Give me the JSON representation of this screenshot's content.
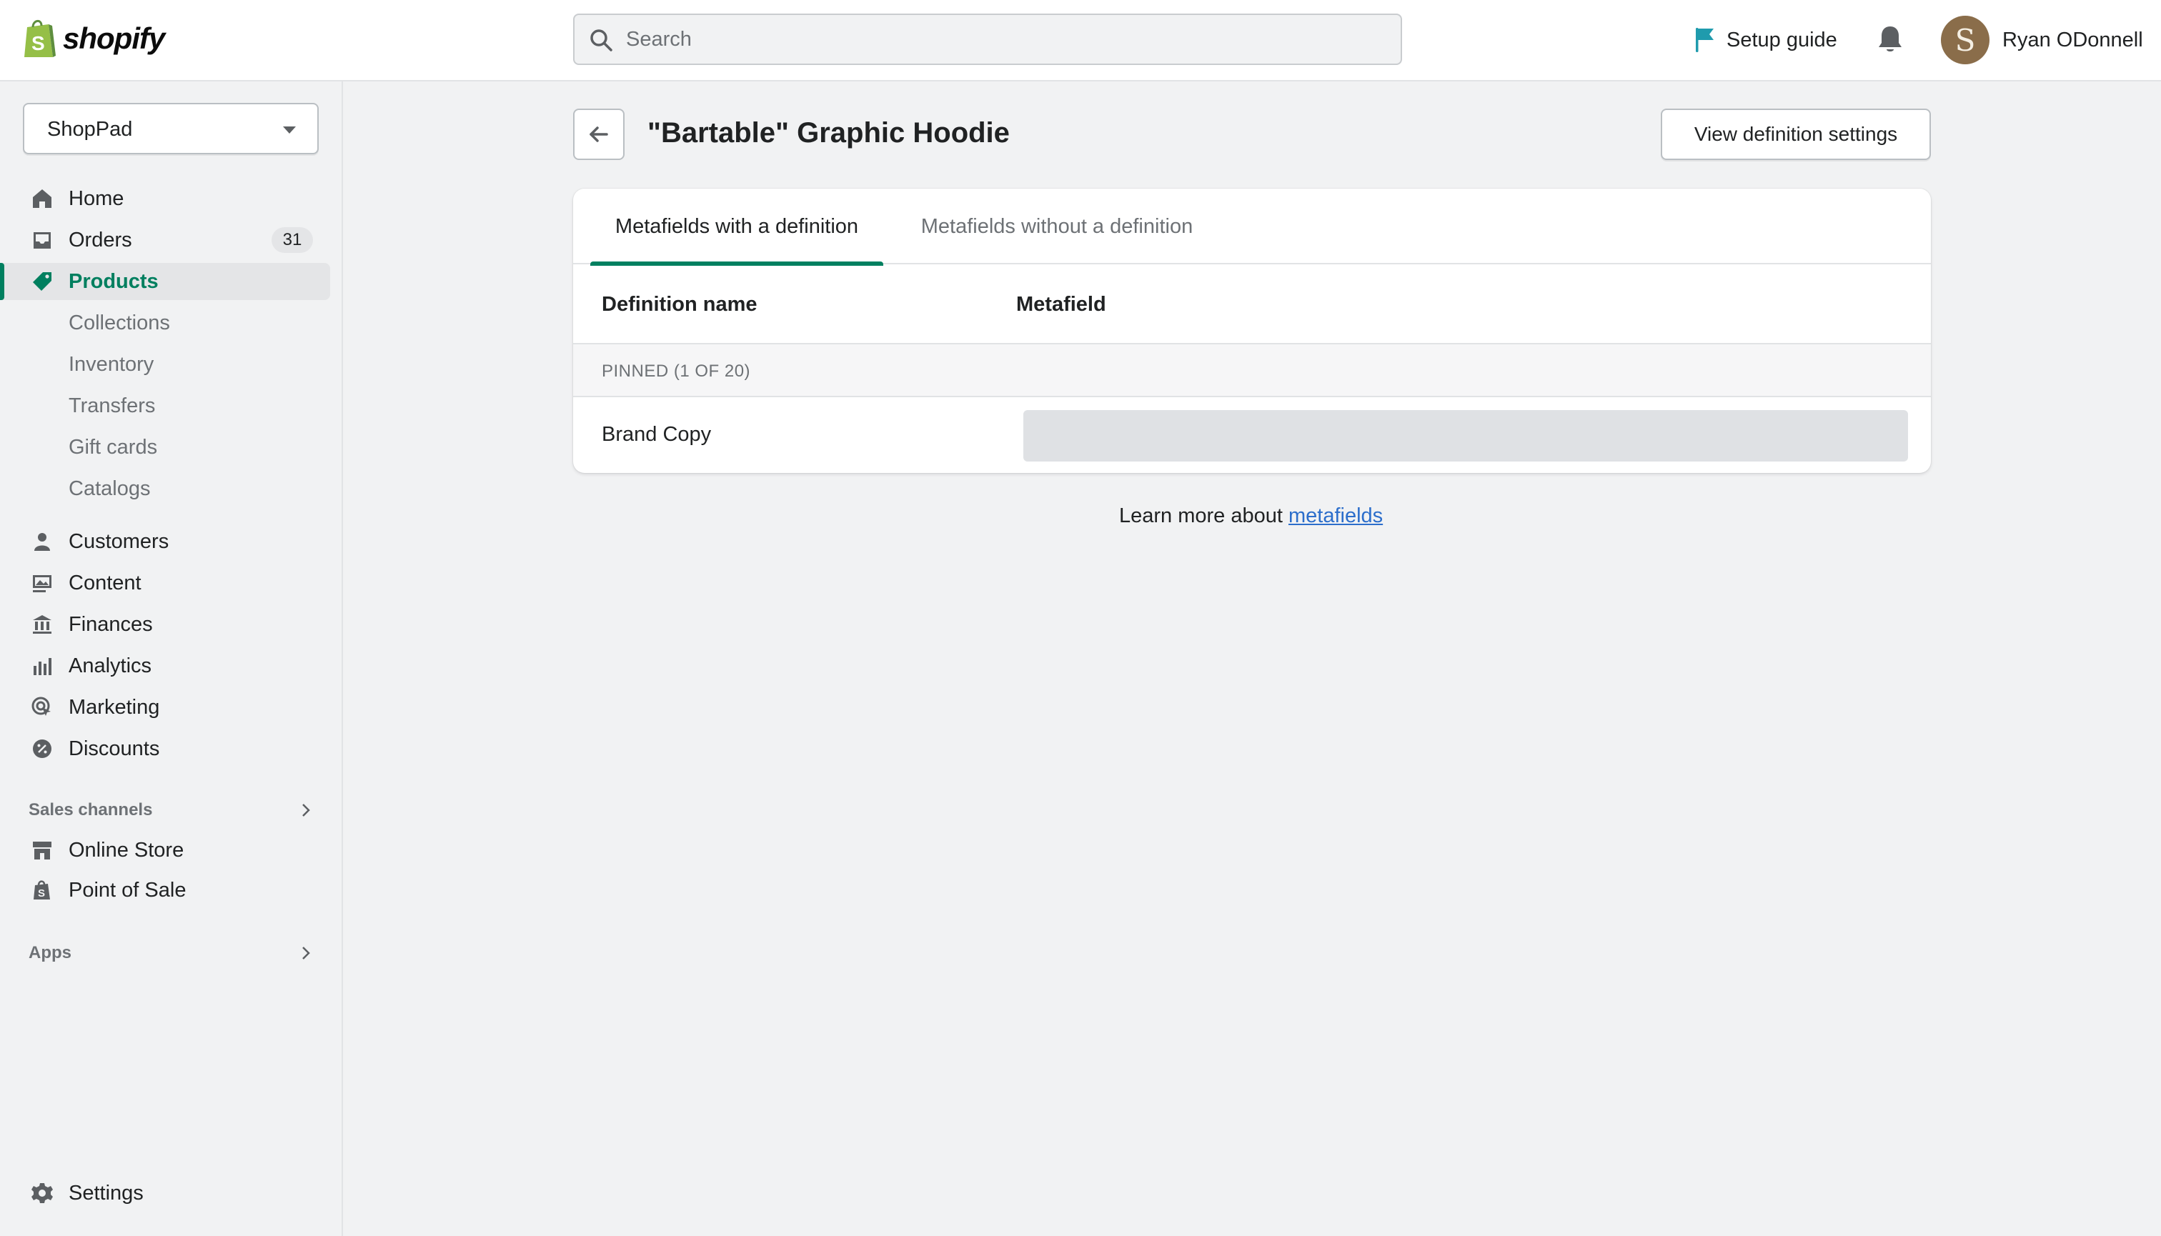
{
  "topbar": {
    "brand": "shopify",
    "search_placeholder": "Search",
    "setup_guide": "Setup guide",
    "user_initial": "S",
    "user_name": "Ryan ODonnell"
  },
  "sidebar": {
    "store": "ShopPad",
    "items": [
      {
        "label": "Home",
        "icon": "home-icon"
      },
      {
        "label": "Orders",
        "icon": "orders-icon",
        "badge": "31"
      },
      {
        "label": "Products",
        "icon": "tag-icon",
        "active": true
      },
      {
        "label": "Collections"
      },
      {
        "label": "Inventory"
      },
      {
        "label": "Transfers"
      },
      {
        "label": "Gift cards"
      },
      {
        "label": "Catalogs"
      },
      {
        "label": "Customers",
        "icon": "person-icon"
      },
      {
        "label": "Content",
        "icon": "content-icon"
      },
      {
        "label": "Finances",
        "icon": "bank-icon"
      },
      {
        "label": "Analytics",
        "icon": "bar-chart-icon"
      },
      {
        "label": "Marketing",
        "icon": "target-icon"
      },
      {
        "label": "Discounts",
        "icon": "discount-icon"
      }
    ],
    "sales_channels": "Sales channels",
    "channels": [
      {
        "label": "Online Store",
        "icon": "store-icon"
      },
      {
        "label": "Point of Sale",
        "icon": "pos-bag-icon"
      }
    ],
    "apps": "Apps",
    "settings": "Settings"
  },
  "main": {
    "title": "\"Bartable\" Graphic Hoodie",
    "view_definition_settings": "View definition settings",
    "tabs": [
      {
        "label": "Metafields with a definition",
        "selected": true
      },
      {
        "label": "Metafields without a definition",
        "selected": false
      }
    ],
    "columns": [
      "Definition name",
      "Metafield"
    ],
    "pinned_label": "PINNED (1 OF 20)",
    "rows": [
      {
        "name": "Brand Copy",
        "value": ""
      }
    ],
    "learn_prefix": "Learn more about ",
    "learn_link": "metafields"
  },
  "colors": {
    "accent_green": "#008060",
    "link_blue": "#2c6ecb",
    "background": "#f1f2f3"
  }
}
